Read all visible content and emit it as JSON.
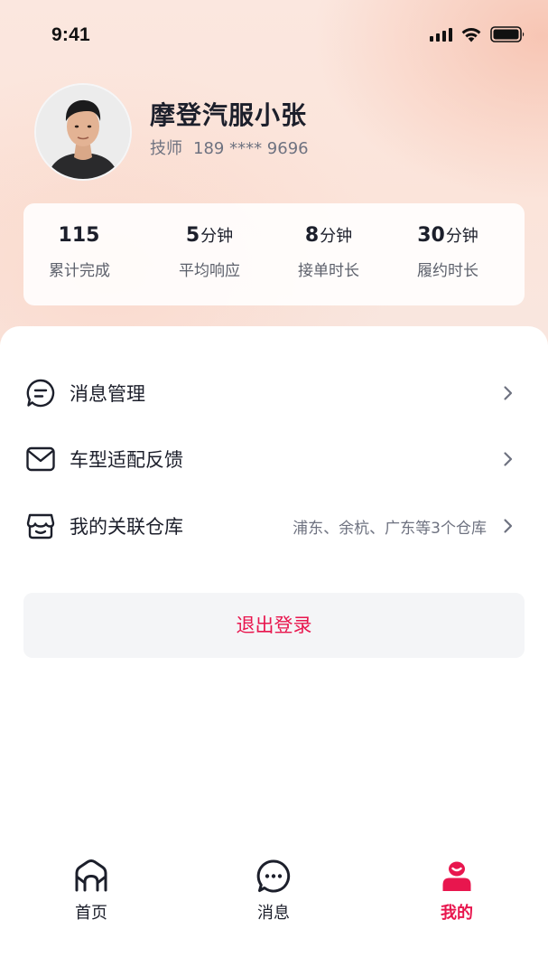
{
  "status_bar": {
    "time": "9:41"
  },
  "profile": {
    "name": "摩登汽服小张",
    "role": "技师",
    "phone": "189 **** 9696"
  },
  "stats": [
    {
      "value": "115",
      "unit": "",
      "label": "累计完成"
    },
    {
      "value": "5",
      "unit": "分钟",
      "label": "平均响应"
    },
    {
      "value": "8",
      "unit": "分钟",
      "label": "接单时长"
    },
    {
      "value": "30",
      "unit": "分钟",
      "label": "履约时长"
    }
  ],
  "menu": [
    {
      "label": "消息管理",
      "icon": "message-bubble-icon",
      "extra": ""
    },
    {
      "label": "车型适配反馈",
      "icon": "mail-icon",
      "extra": ""
    },
    {
      "label": "我的关联仓库",
      "icon": "warehouse-icon",
      "extra": "浦东、余杭、广东等3个仓库"
    }
  ],
  "logout_label": "退出登录",
  "tabs": [
    {
      "label": "首页",
      "icon": "home-icon",
      "active": false
    },
    {
      "label": "消息",
      "icon": "chat-icon",
      "active": false
    },
    {
      "label": "我的",
      "icon": "user-icon",
      "active": true
    }
  ],
  "colors": {
    "accent": "#e8164e",
    "text_primary": "#1c1f2b",
    "text_secondary": "#6e7280",
    "logout_bg": "#f4f5f7"
  }
}
